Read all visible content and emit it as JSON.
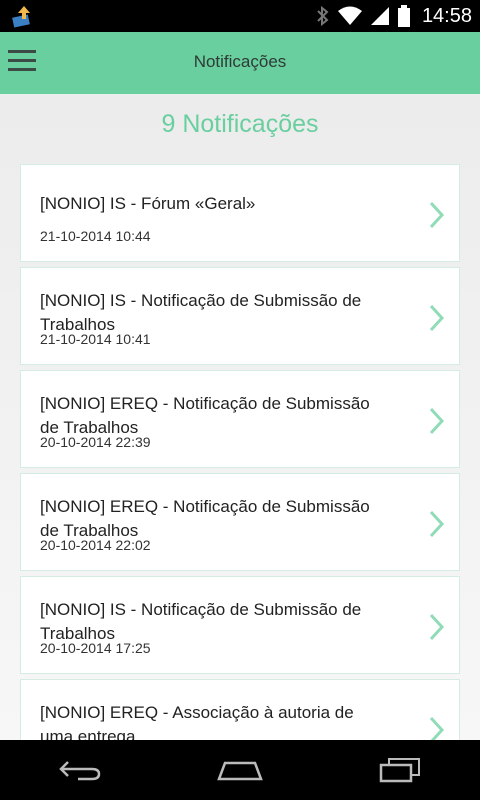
{
  "status_bar": {
    "time": "14:58",
    "icons": [
      "download-icon",
      "bluetooth-icon",
      "wifi-icon",
      "signal-icon",
      "battery-icon"
    ]
  },
  "app_bar": {
    "title": "Notificações",
    "menu_icon": "hamburger-menu-icon"
  },
  "summary": {
    "count_label": "9 Notificações"
  },
  "notifications": [
    {
      "title": "[NONIO] IS - Fórum «Geral»",
      "date": "21-10-2014 10:44"
    },
    {
      "title": "[NONIO] IS - Notificação de Submissão de Trabalhos",
      "date": "21-10-2014 10:41"
    },
    {
      "title": "[NONIO] EREQ - Notificação de Submissão de Trabalhos",
      "date": "20-10-2014 22:39"
    },
    {
      "title": "[NONIO] EREQ - Notificação de Submissão de Trabalhos",
      "date": "20-10-2014 22:02"
    },
    {
      "title": "[NONIO] IS - Notificação de Submissão de Trabalhos",
      "date": "20-10-2014 17:25"
    },
    {
      "title": "[NONIO] EREQ - Associação à autoria de uma entrega",
      "date": ""
    }
  ],
  "nav_bar": {
    "icons": [
      "back-icon",
      "home-icon",
      "recent-apps-icon"
    ]
  },
  "colors": {
    "accent": "#69cf9f",
    "chevron": "#8fdcb6"
  }
}
